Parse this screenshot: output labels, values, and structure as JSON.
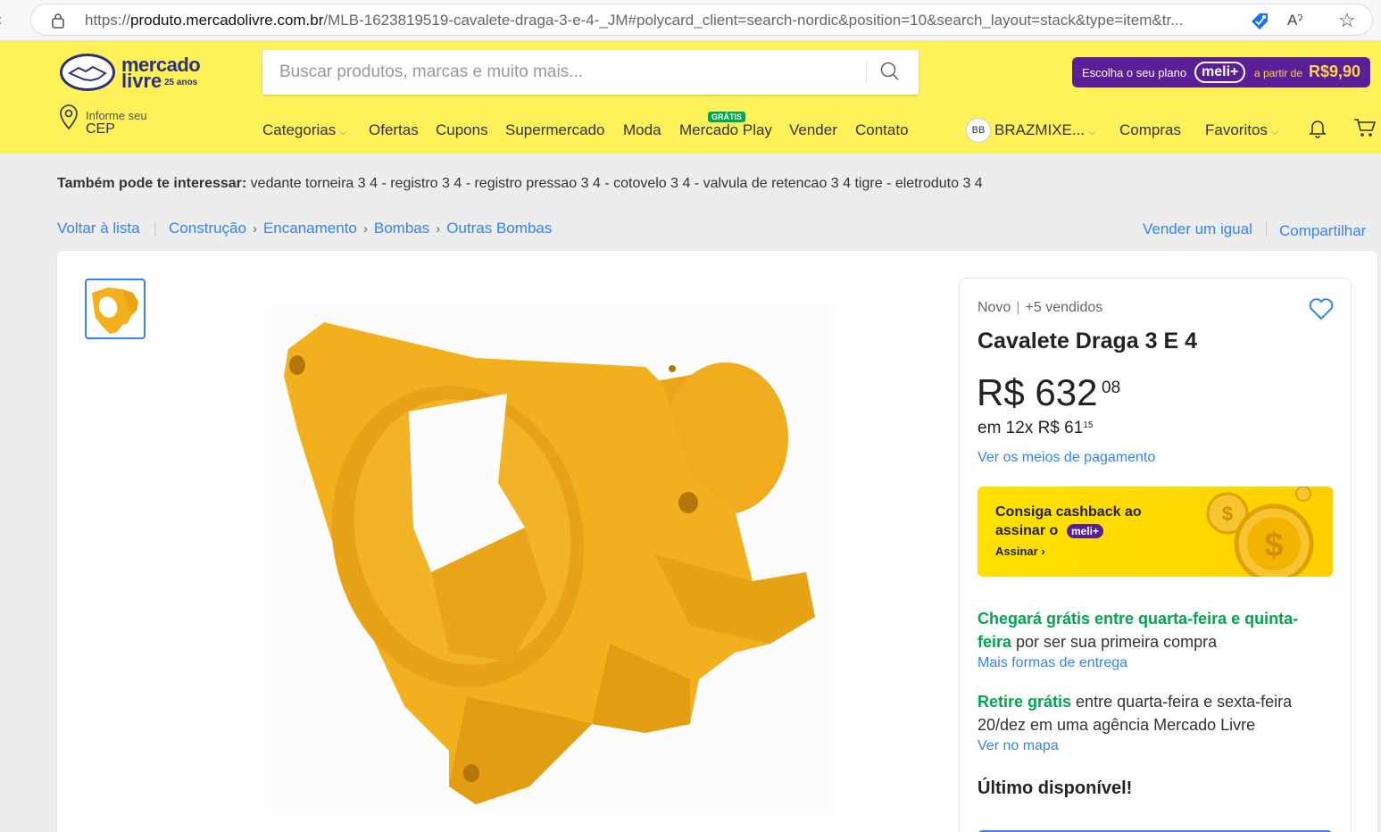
{
  "browser": {
    "url_prefix": "https://",
    "url_host": "produto.mercadolivre.com.br",
    "url_path": "/MLB-1623819519-cavalete-draga-3-e-4-_JM#polycard_client=search-nordic&position=10&search_layout=stack&type=item&tr..."
  },
  "header": {
    "logo_line1": "mercado",
    "logo_line2": "livre",
    "logo_anos": "25 anos",
    "search_placeholder": "Buscar produtos, marcas e muito mais...",
    "meli_banner": {
      "lead": "Escolha o seu plano",
      "brand": "meli+",
      "from": "a partir de",
      "price": "R$9,90"
    },
    "location": {
      "line1": "Informe seu",
      "line2": "CEP"
    },
    "nav": [
      {
        "label": "Categorias",
        "has_chevron": true
      },
      {
        "label": "Ofertas"
      },
      {
        "label": "Cupons"
      },
      {
        "label": "Supermercado"
      },
      {
        "label": "Moda"
      },
      {
        "label": "Mercado Play",
        "badge": "GRÁTIS"
      },
      {
        "label": "Vender"
      },
      {
        "label": "Contato"
      }
    ],
    "user": {
      "initials": "BB",
      "name": "BRAZMIXE..."
    },
    "compras": "Compras",
    "favoritos": "Favoritos"
  },
  "interest": {
    "label": "Também pode te interessar:",
    "items": "vedante torneira 3 4 - registro 3 4 - registro pressao 3 4 - cotovelo 3 4 - valvula de retencao 3 4 tigre - eletroduto 3 4"
  },
  "breadcrumbs": {
    "back": "Voltar à lista",
    "items": [
      "Construção",
      "Encanamento",
      "Bombas",
      "Outras Bombas"
    ],
    "sell_same": "Vender um igual",
    "share": "Compartilhar"
  },
  "product": {
    "condition": "Novo",
    "sold": "+5 vendidos",
    "title": "Cavalete Draga 3 E 4",
    "price_main": "R$ 632",
    "price_cents": "08",
    "installments_prefix": "em 12x R$ 61",
    "installments_cents": "15",
    "payment_link": "Ver os meios de pagamento",
    "cashback": {
      "line1": "Consiga cashback ao",
      "line2": "assinar o",
      "brand": "meli+",
      "cta": "Assinar"
    },
    "shipping": {
      "green": "Chegará grátis entre quarta-feira e quinta-feira",
      "rest": " por ser sua primeira compra",
      "link": "Mais formas de entrega"
    },
    "pickup": {
      "green": "Retire grátis",
      "rest": " entre quarta-feira e sexta-feira 20/dez em uma agência Mercado Livre",
      "link": "Ver no mapa"
    },
    "stock": "Último disponível!"
  },
  "colors": {
    "header_yellow": "#fff159",
    "link_blue": "#3483fa",
    "green": "#00a650",
    "meli_purple": "#5a1f96",
    "product_orange": "#f2b01e"
  },
  "icons": [
    "lock-icon",
    "tag-icon",
    "read-aloud-icon",
    "star-icon",
    "search-icon",
    "location-pin-icon",
    "bell-icon",
    "cart-icon",
    "heart-icon",
    "chevron-right-icon",
    "chevron-down-icon"
  ]
}
